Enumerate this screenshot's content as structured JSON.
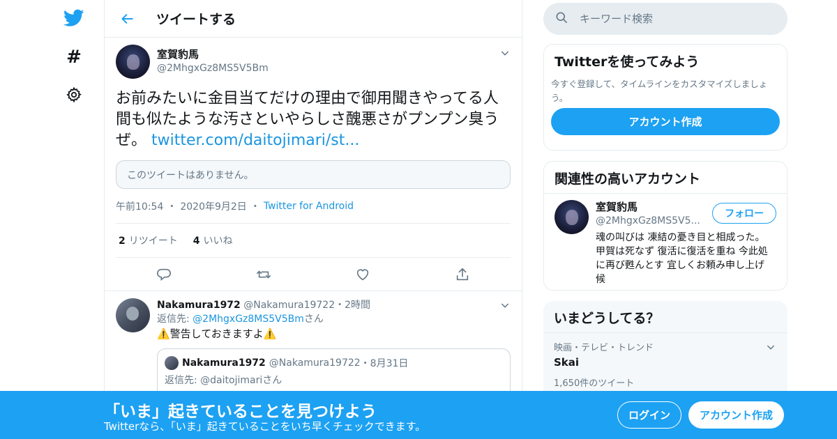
{
  "nav": {
    "logo_icon": "twitter-bird-icon",
    "explore_icon": "hashtag-icon",
    "explore_glyph": "#",
    "settings_icon": "gear-icon"
  },
  "header": {
    "title": "ツイートする"
  },
  "tweet": {
    "display_name": "室賀豹馬",
    "screen_name": "@2MhgxGz8MS5V5Bm",
    "text": "お前みたいに金目当てだけの理由で御用聞きやってる人間も似たような汚さといやらしさ醜悪さがプンプン臭うぜ。",
    "link": "twitter.com/daitojimari/st...",
    "unavailable": "このツイートはありません。",
    "time": "午前10:54",
    "date": "2020年9月2日",
    "sep": "・",
    "source": "Twitter for Android",
    "retweets_count": "2",
    "retweets_label": "リツイート",
    "likes_count": "4",
    "likes_label": "いいね"
  },
  "reply": {
    "display_name": "Nakamura1972",
    "screen_name": "@Nakamura19722",
    "time": "2時間",
    "replying_prefix": "返信先:",
    "replying_mention": "@2MhgxGz8MS5V5Bm",
    "replying_suffix": "さん",
    "text": "⚠️警告しておきますよ⚠️",
    "quoted": {
      "display_name": "Nakamura1972",
      "screen_name": "@Nakamura19722",
      "time": "8月31日",
      "replying": "返信先: @daitojimariさん"
    }
  },
  "search": {
    "placeholder": "キーワード検索"
  },
  "signup_card": {
    "title": "Twitterを使ってみよう",
    "description": "今すぐ登録して、タイムラインをカスタマイズしましょう。",
    "button": "アカウント作成"
  },
  "related_card": {
    "title": "関連性の高いアカウント",
    "display_name": "室賀豹馬",
    "screen_name": "@2MhgxGz8MS5V5...",
    "follow": "フォロー",
    "bio": "魂の叫びは 凍結の憂き目と相成った。 甲賀は死なず 復活に復活を重ね 今此処に再び甦んとす 宜しくお頼み申し上げ候"
  },
  "trends_card": {
    "title": "いまどうしてる？",
    "category": "映画・テレビ・トレンド",
    "name": "Skai",
    "count": "1,650件のツイート"
  },
  "banner": {
    "title": "「いま」起きていることを見つけよう",
    "subtitle": "Twitterなら、「いま」起きていることをいち早くチェックできます。",
    "login": "ログイン",
    "signup": "アカウント作成"
  },
  "colors": {
    "accent": "#1da1f2",
    "link": "#1b95e0",
    "secondary_text": "#657786",
    "border": "#e6ecf0"
  }
}
